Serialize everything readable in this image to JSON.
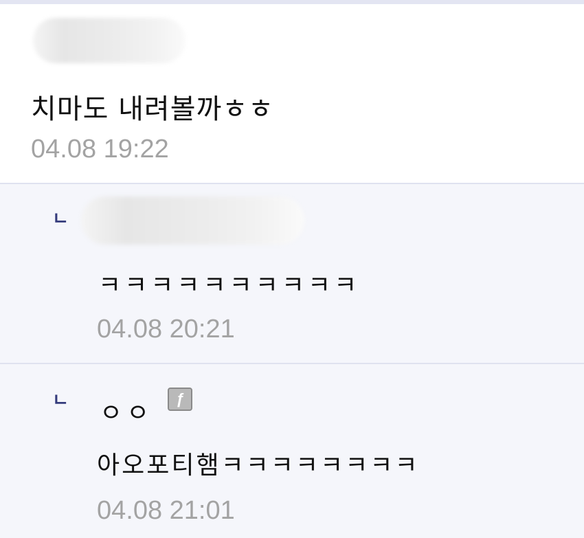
{
  "comments": [
    {
      "text": "치마도 내려볼까ㅎㅎ",
      "timestamp": "04.08 19:22"
    }
  ],
  "replies": [
    {
      "reply_mark": "ㄴ",
      "text": "ㅋㅋㅋㅋㅋㅋㅋㅋㅋㅋ",
      "timestamp": "04.08 20:21"
    },
    {
      "reply_mark": "ㄴ",
      "nickname": "ㅇㅇ",
      "level_icon": "level-badge-icon",
      "level_icon_glyph": "ƒ",
      "text": "아오포티햄ㅋㅋㅋㅋㅋㅋㅋㅋ",
      "timestamp": "04.08 21:01"
    }
  ]
}
